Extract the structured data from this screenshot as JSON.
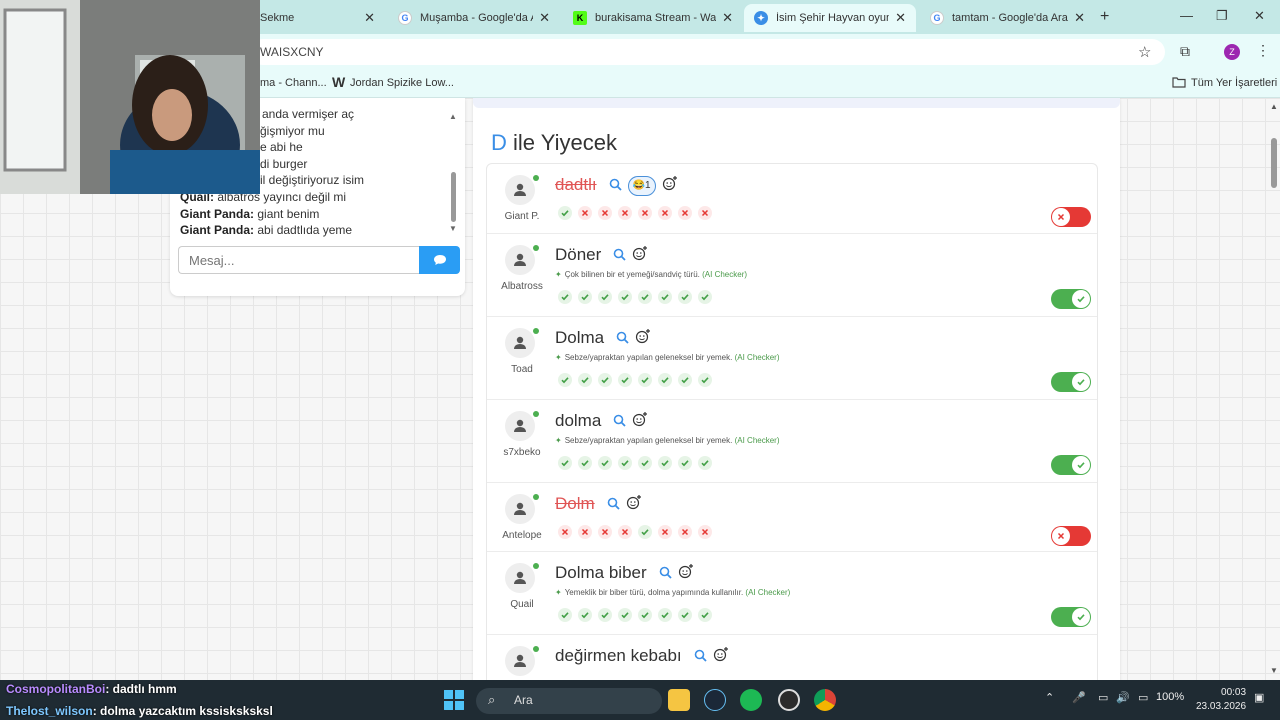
{
  "browser": {
    "tabs": [
      {
        "title": "Sekme",
        "favicon": "tab-icon",
        "active": false
      },
      {
        "title": "Muşamba - Google'da Ara",
        "favicon": "google-icon",
        "active": false
      },
      {
        "title": "burakisama Stream - Watc",
        "favicon": "kick-icon",
        "active": false
      },
      {
        "title": "İsim Şehir Hayvan oyununa",
        "favicon": "game-icon",
        "active": true
      },
      {
        "title": "tamtam - Google'da Ara",
        "favicon": "google-icon",
        "active": false
      }
    ],
    "url": "WAISXCNY",
    "bookmarks": [
      {
        "label": "ma - Chann..."
      },
      {
        "label": "Jordan Spizike Low..."
      }
    ],
    "all_bookmarks": "Tüm Yer İşaretleri",
    "profile_initial": "Z"
  },
  "chat": {
    "lines": [
      {
        "user": "",
        "text": "anda vermişer aç"
      },
      {
        "user": "",
        "text": "ğişmiyor mu"
      },
      {
        "user": "",
        "text": "e abi he"
      },
      {
        "user": "",
        "text": "di burger"
      },
      {
        "user": "",
        "text": "il değiştiriyoruz isim"
      },
      {
        "user": "Quail:",
        "text": "albatros yayıncı değil mi"
      },
      {
        "user": "Giant Panda:",
        "text": "giant benim"
      },
      {
        "user": "Giant Panda:",
        "text": "abi dadtlıda yeme"
      }
    ],
    "input_placeholder": "Mesaj..."
  },
  "category": {
    "letter": "D",
    "title": "ile Yiyecek"
  },
  "answers": [
    {
      "player": "Giant P.",
      "word": "dadtlı",
      "rejected": true,
      "reaction": "😂1",
      "note": "",
      "votes": [
        "ok",
        "no",
        "no",
        "no",
        "no",
        "no",
        "no",
        "no"
      ],
      "accepted": false
    },
    {
      "player": "Albatross",
      "word": "Döner",
      "rejected": false,
      "reaction": "",
      "note": "Çok bilinen bir et yemeği/sandviç türü.",
      "ai": "(AI Checker)",
      "votes": [
        "ok",
        "ok",
        "ok",
        "ok",
        "ok",
        "ok",
        "ok",
        "ok"
      ],
      "accepted": true
    },
    {
      "player": "Toad",
      "word": "Dolma",
      "rejected": false,
      "reaction": "",
      "note": "Sebze/yapraktan yapılan geleneksel bir yemek.",
      "ai": "(AI Checker)",
      "votes": [
        "ok",
        "ok",
        "ok",
        "ok",
        "ok",
        "ok",
        "ok",
        "ok"
      ],
      "accepted": true
    },
    {
      "player": "s7xbeko",
      "word": "dolma",
      "rejected": false,
      "reaction": "",
      "note": "Sebze/yapraktan yapılan geleneksel bir yemek.",
      "ai": "(AI Checker)",
      "votes": [
        "ok",
        "ok",
        "ok",
        "ok",
        "ok",
        "ok",
        "ok",
        "ok"
      ],
      "accepted": true
    },
    {
      "player": "Antelope",
      "word": "Dolm",
      "rejected": true,
      "reaction": "",
      "note": "",
      "votes": [
        "no",
        "no",
        "no",
        "no",
        "ok",
        "no",
        "no",
        "no"
      ],
      "accepted": false
    },
    {
      "player": "Quail",
      "word": "Dolma biber",
      "rejected": false,
      "reaction": "",
      "note": "Yemeklik bir biber türü, dolma yapımında kullanılır.",
      "ai": "(AI Checker)",
      "votes": [
        "ok",
        "ok",
        "ok",
        "ok",
        "ok",
        "ok",
        "ok",
        "ok"
      ],
      "accepted": true
    },
    {
      "player": "",
      "word": "değirmen kebabı",
      "rejected": false,
      "reaction": "",
      "note": "",
      "votes": [],
      "accepted": true
    }
  ],
  "stream_chat": [
    {
      "user": "CosmopolitanBoi",
      "text": ": dadtlı hmm"
    },
    {
      "user": "Thelost_wilson",
      "text": ": dolma yazcaktım kssisksksksl"
    }
  ],
  "taskbar": {
    "search_label": "Ara",
    "battery": "100%",
    "time": "00:03",
    "date": "23.03.2026"
  },
  "colors": {
    "accent": "#3a8ee6",
    "accept": "#4caf50",
    "reject": "#e53935"
  }
}
